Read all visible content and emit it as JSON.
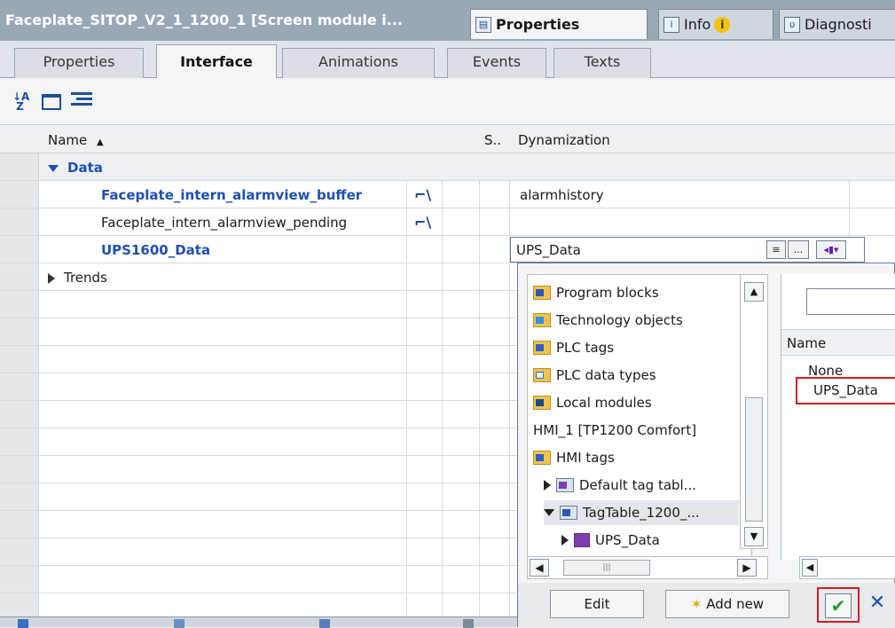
{
  "titlebar": {
    "title": "Faceplate_SITOP_V2_1_1200_1 [Screen module i...",
    "properties_tab": "Properties",
    "info_tab": "Info",
    "info_badge": "i",
    "diagnostics_tab": "Diagnosti"
  },
  "tabs": [
    "Properties",
    "Interface",
    "Animations",
    "Events",
    "Texts"
  ],
  "active_tab": "Interface",
  "grid": {
    "headers": {
      "name": "Name",
      "s": "S..",
      "dynamization": "Dynamization"
    },
    "rows": [
      {
        "name": "Data",
        "dynamization": ""
      },
      {
        "name": "Faceplate_intern_alarmview_buffer",
        "dynamization": "alarmhistory"
      },
      {
        "name": "Faceplate_intern_alarmview_pending",
        "dynamization": ""
      },
      {
        "name": "UPS1600_Data",
        "dynamization": "UPS_Data"
      },
      {
        "name": "Trends",
        "dynamization": ""
      }
    ]
  },
  "dyn_input_buttons": {
    "browse": "...",
    "list": "≡"
  },
  "popup": {
    "tree": [
      {
        "label": "Program blocks",
        "icon": "program-blocks-icon"
      },
      {
        "label": "Technology objects",
        "icon": "technology-objects-icon"
      },
      {
        "label": "PLC tags",
        "icon": "plc-tags-icon"
      },
      {
        "label": "PLC data types",
        "icon": "plc-data-types-icon"
      },
      {
        "label": "Local modules",
        "icon": "local-modules-icon"
      },
      {
        "label": "HMI_1 [TP1200 Comfort]",
        "icon": ""
      },
      {
        "label": "HMI tags",
        "icon": "hmi-tags-icon"
      },
      {
        "label": "Default tag tabl...",
        "icon": "tag-table-icon"
      },
      {
        "label": "TagTable_1200_...",
        "icon": "tag-table-icon"
      },
      {
        "label": "UPS_Data",
        "icon": "udt-icon"
      }
    ],
    "column_header": "Name",
    "options": [
      "None",
      "UPS_Data"
    ],
    "edit_button": "Edit",
    "add_new_button": "Add new"
  }
}
